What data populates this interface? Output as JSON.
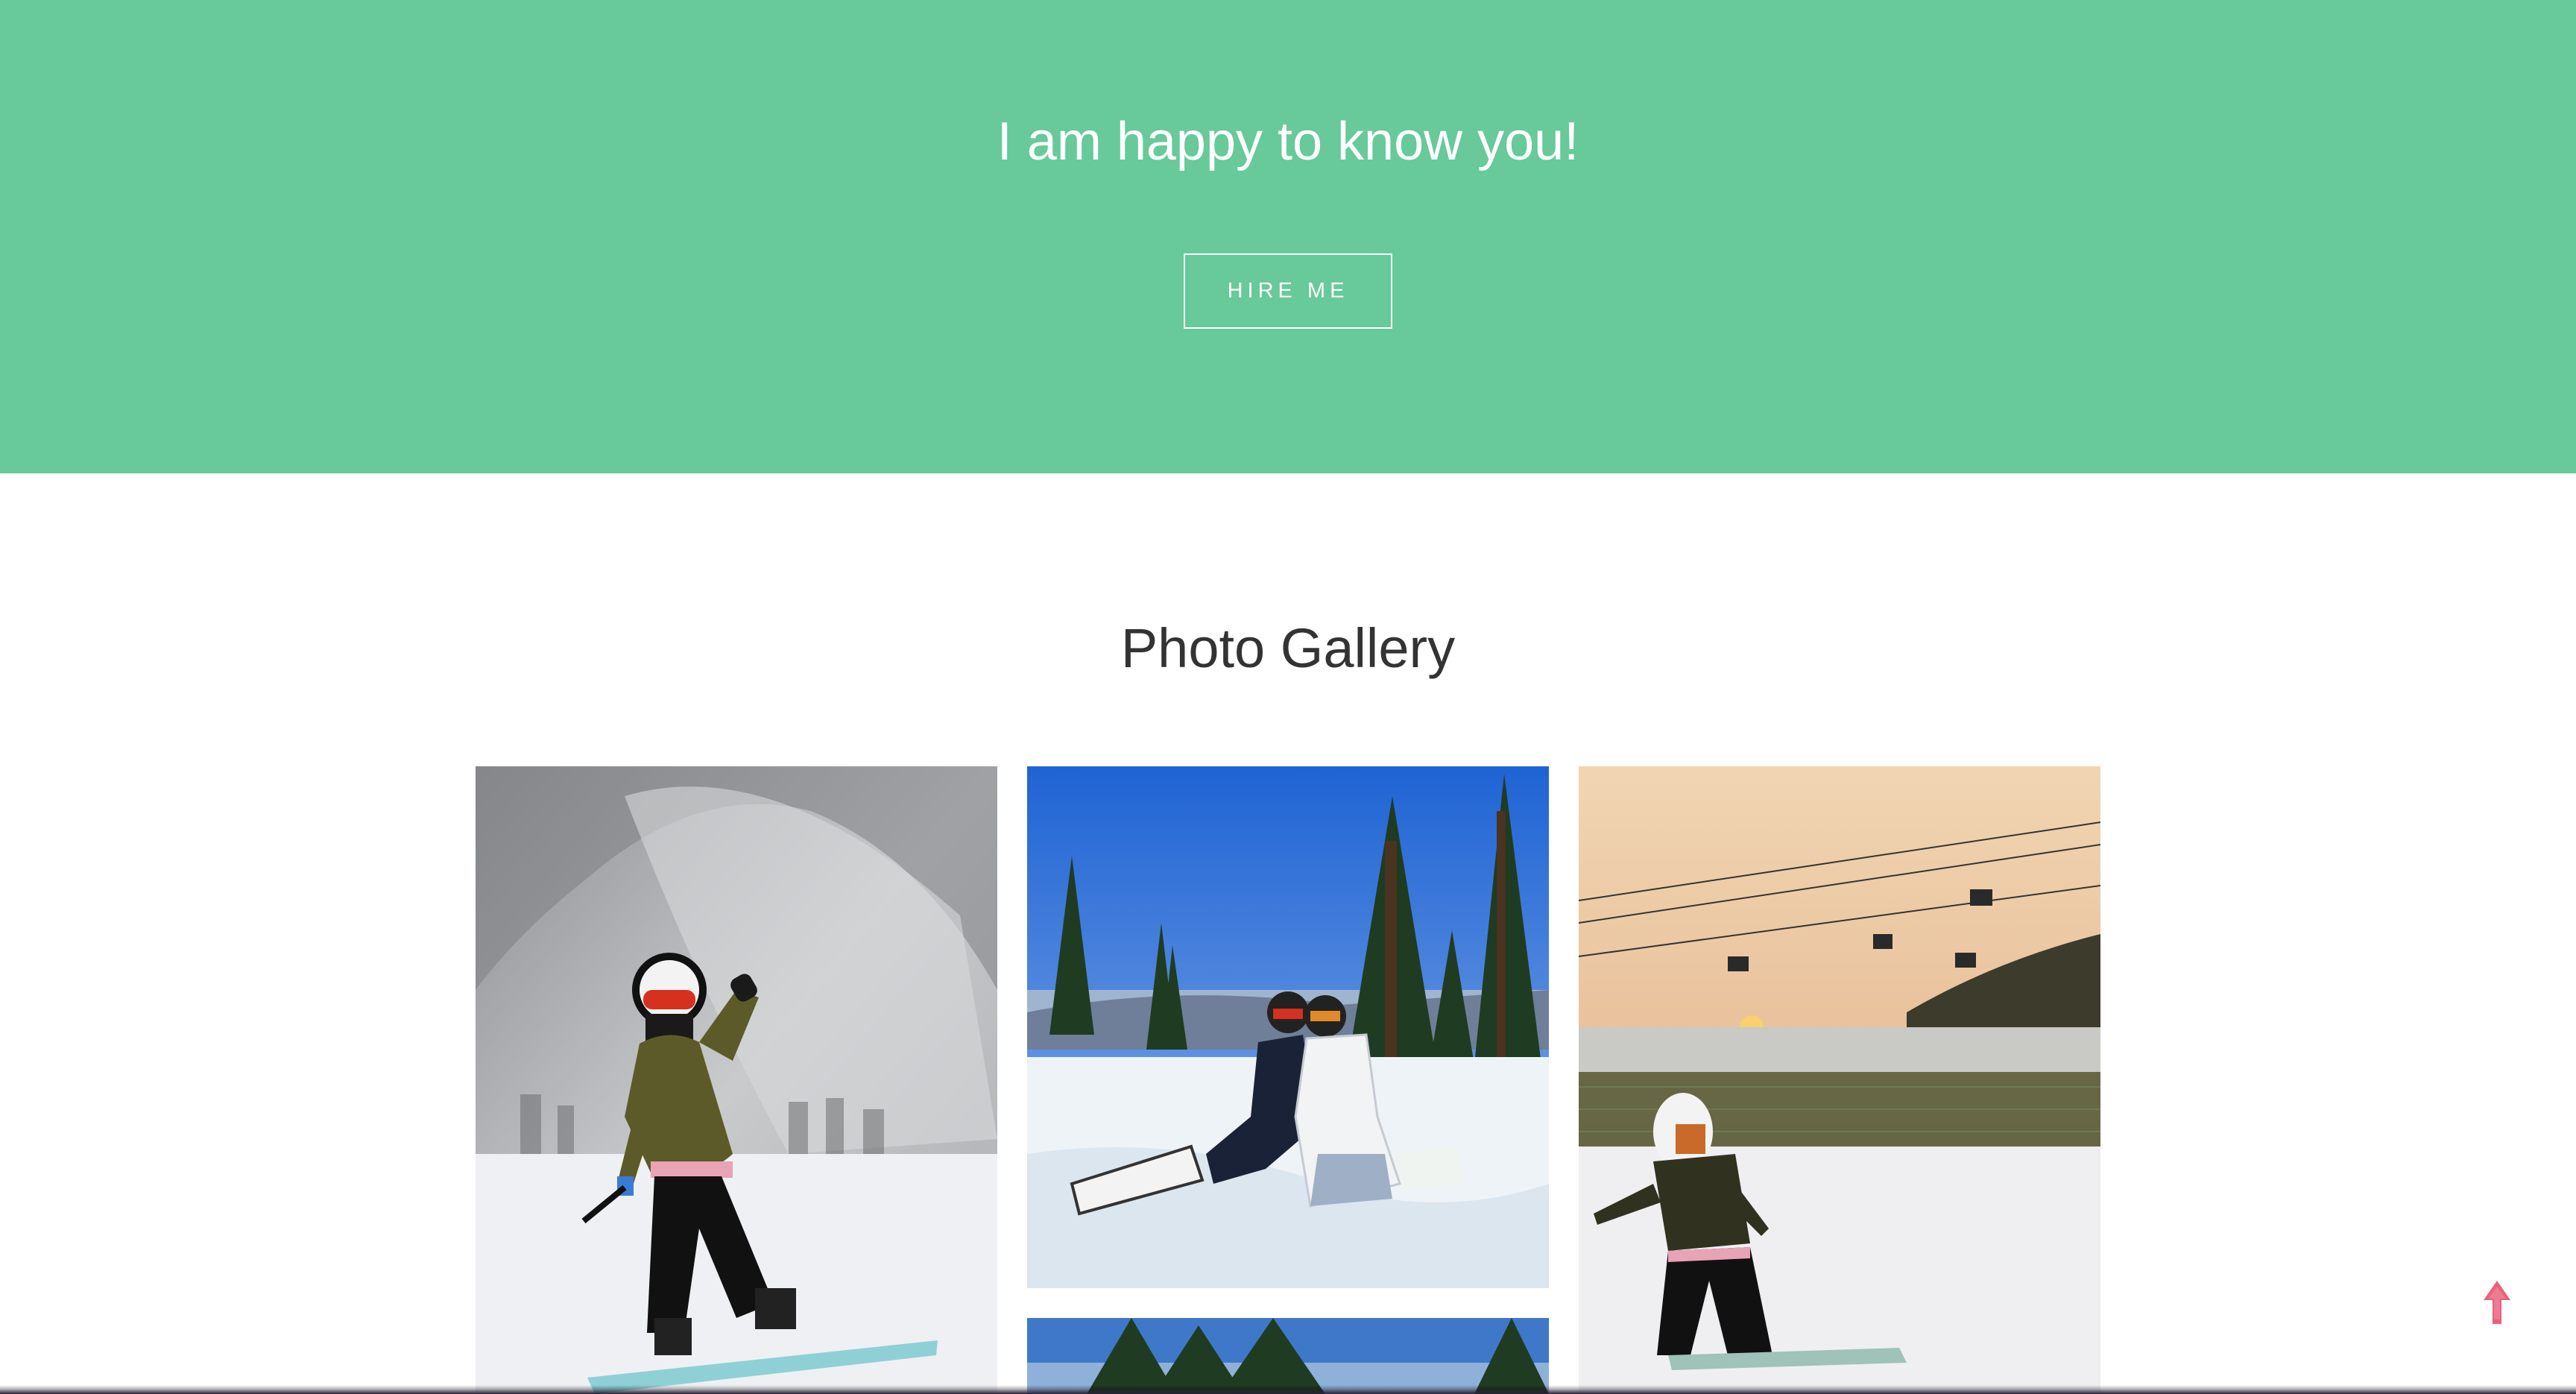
{
  "hero": {
    "title": "I am happy to know you!",
    "button_label": "HIRE ME",
    "background_color": "#68c99b"
  },
  "gallery": {
    "title": "Photo Gallery",
    "photos": [
      {
        "alt": "Snowboarder in olive jacket and red goggles waving on a snowy slope"
      },
      {
        "alt": "Two snowboarders kneeling on snow with pine trees and blue sky"
      },
      {
        "alt": "Snowboarder in bear hat at sunset under a chairlift"
      },
      {
        "alt": "Pine trees against blue sky"
      }
    ]
  },
  "scroll_top": {
    "icon": "arrow-up-icon",
    "color": "#e8617a"
  }
}
